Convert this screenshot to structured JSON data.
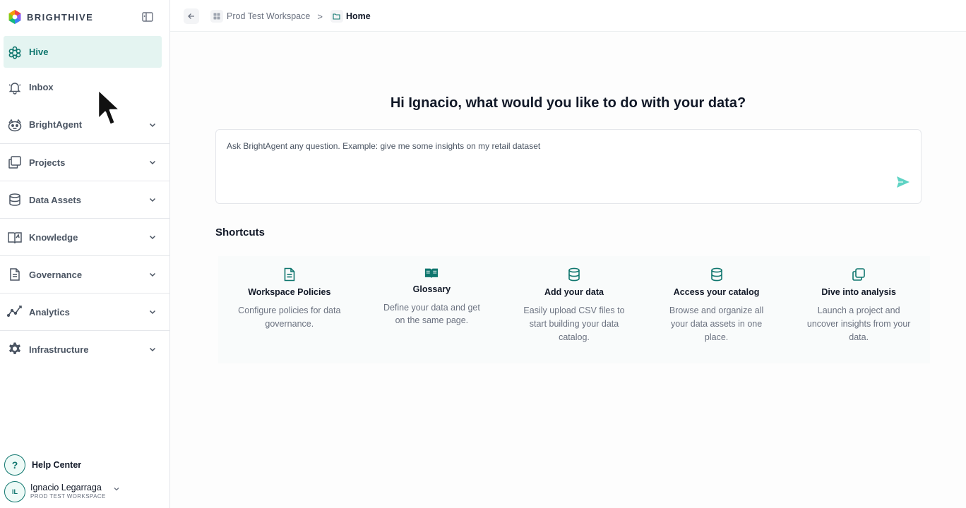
{
  "brand": {
    "name": "BRIGHTHIVE",
    "accent": "#0f766e",
    "active_bg": "#e4f4f1"
  },
  "sidebar": {
    "items": [
      {
        "label": "Hive",
        "icon": "hive-icon",
        "active": true,
        "expandable": false
      },
      {
        "label": "Inbox",
        "icon": "bell-icon",
        "active": false,
        "expandable": false
      },
      {
        "label": "BrightAgent",
        "icon": "agent-icon",
        "active": false,
        "expandable": true
      },
      {
        "label": "Projects",
        "icon": "projects-icon",
        "active": false,
        "expandable": true
      },
      {
        "label": "Data Assets",
        "icon": "database-icon",
        "active": false,
        "expandable": true
      },
      {
        "label": "Knowledge",
        "icon": "book-icon",
        "active": false,
        "expandable": true
      },
      {
        "label": "Governance",
        "icon": "document-icon",
        "active": false,
        "expandable": true
      },
      {
        "label": "Analytics",
        "icon": "analytics-icon",
        "active": false,
        "expandable": true
      },
      {
        "label": "Infrastructure",
        "icon": "gear-icon",
        "active": false,
        "expandable": true
      }
    ],
    "help": {
      "label": "Help Center",
      "glyph": "?"
    },
    "user": {
      "initials": "IL",
      "name": "Ignacio Legarraga",
      "workspace": "PROD TEST WORKSPACE"
    }
  },
  "breadcrumb": {
    "workspace": "Prod Test Workspace",
    "separator": ">",
    "current": "Home"
  },
  "main": {
    "greeting": "Hi Ignacio, what would you like to do with your data?",
    "ask_placeholder": "Ask BrightAgent any question. Example: give me some insights on my retail dataset",
    "shortcuts_title": "Shortcuts",
    "shortcuts": [
      {
        "title": "Workspace Policies",
        "desc": "Configure policies for data governance.",
        "icon": "document-icon"
      },
      {
        "title": "Glossary",
        "desc": "Define your data and get on the same page.",
        "icon": "open-book-icon"
      },
      {
        "title": "Add your data",
        "desc": "Easily upload CSV files to start building your data catalog.",
        "icon": "database-icon"
      },
      {
        "title": "Access your catalog",
        "desc": "Browse and organize all your data assets in one place.",
        "icon": "database-icon"
      },
      {
        "title": "Dive into analysis",
        "desc": "Launch a project and uncover insights from your data.",
        "icon": "copy-icon"
      }
    ]
  }
}
